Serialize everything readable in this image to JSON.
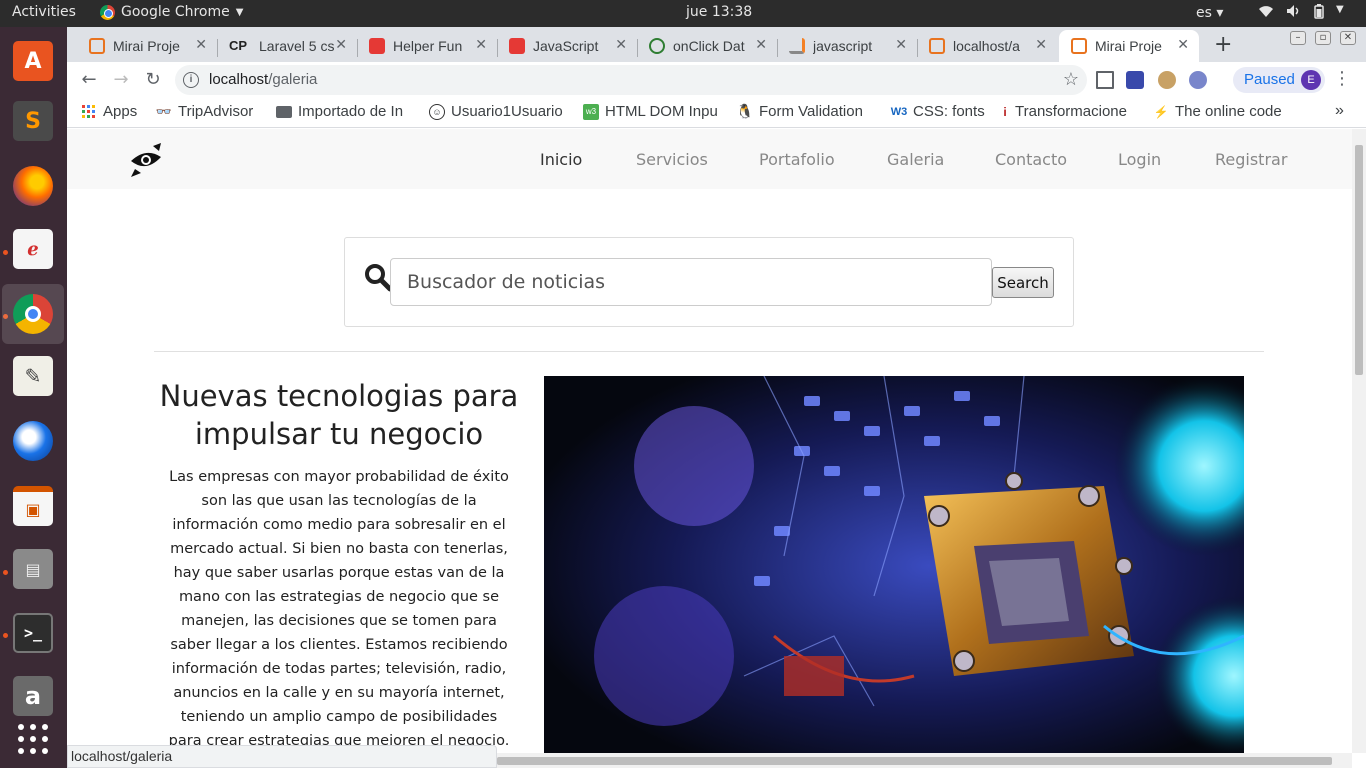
{
  "os": {
    "activities": "Activities",
    "app_name": "Google Chrome",
    "clock": "jue 13:38",
    "language": "es"
  },
  "tabs": [
    {
      "title": "Mirai Proje",
      "favicon": "xampp-icon",
      "color": "#e8731f"
    },
    {
      "title": "Laravel 5 cs",
      "favicon": "cp-icon",
      "color": "#333333"
    },
    {
      "title": "Helper Fun",
      "favicon": "laravel-icon",
      "color": "#e53935"
    },
    {
      "title": "JavaScript",
      "favicon": "laravel-icon",
      "color": "#e53935"
    },
    {
      "title": "onClick Dat",
      "favicon": "code-icon",
      "color": "#2e7d32"
    },
    {
      "title": "javascript",
      "favicon": "stackoverflow-icon",
      "color": "#f48024"
    },
    {
      "title": "localhost/a",
      "favicon": "xampp-icon",
      "color": "#e8731f"
    },
    {
      "title": "Mirai Proje",
      "favicon": "xampp-icon",
      "color": "#e8731f",
      "active": true
    }
  ],
  "toolbar": {
    "url_host": "localhost",
    "url_path": "/galeria",
    "paused_label": "Paused",
    "avatar_letter": "E"
  },
  "bookmarks": [
    {
      "label": "Apps",
      "icon": "apps-grid-icon"
    },
    {
      "label": "TripAdvisor",
      "icon": "tripadvisor-icon"
    },
    {
      "label": "Importado de In",
      "icon": "folder-icon"
    },
    {
      "label": "Usuario1Usuario",
      "icon": "smiley-icon"
    },
    {
      "label": "HTML DOM Inpu",
      "icon": "w3-green-icon"
    },
    {
      "label": "Form Validation",
      "icon": "linux-icon"
    },
    {
      "label": "CSS: fonts",
      "icon": "w3schools-icon"
    },
    {
      "label": "Transformacione",
      "icon": "info-icon"
    },
    {
      "label": "The online code",
      "icon": "bolt-icon"
    }
  ],
  "site": {
    "nav": [
      "Inicio",
      "Servicios",
      "Portafolio",
      "Galeria",
      "Contacto",
      "Login",
      "Registrar"
    ],
    "search_placeholder": "Buscador de noticias",
    "search_button": "Search",
    "article_title": "Nuevas tecnologias para impulsar tu negocio",
    "article_body": "Las empresas con mayor probabilidad de éxito son las que usan las tecnologías de la información como medio para sobresalir en el mercado actual. Si bien no basta con tenerlas, hay que saber usarlas porque estas van de la mano con las estrategias de negocio que se manejen, las decisiones que se tomen para saber llegar a los clientes. Estamos recibiendo información de todas partes; televisión, radio, anuncios en la calle y en su mayoría internet, teniendo un amplio campo de posibilidades para crear estrategias que mejoren el negocio."
  },
  "status_url": "localhost/galeria"
}
